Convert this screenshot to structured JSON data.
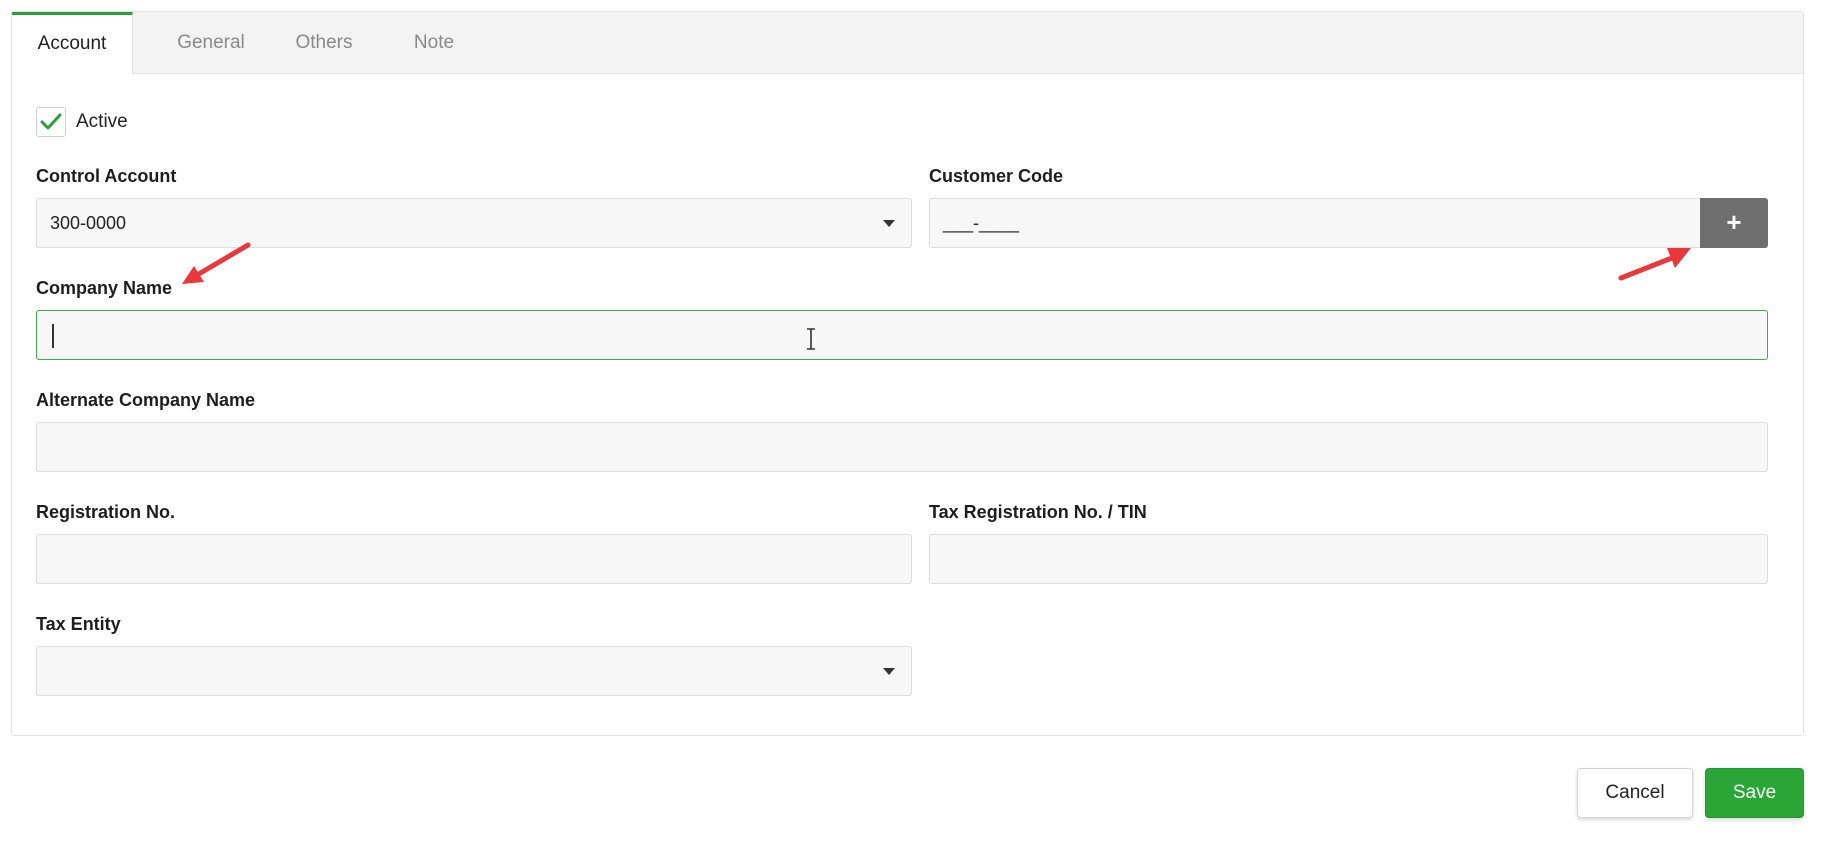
{
  "tabs": [
    {
      "label": "Account",
      "active": true
    },
    {
      "label": "General",
      "active": false
    },
    {
      "label": "Others",
      "active": false
    },
    {
      "label": "Note",
      "active": false
    }
  ],
  "active_checkbox": {
    "label": "Active",
    "checked": true
  },
  "fields": {
    "control_account": {
      "label": "Control Account",
      "value": "300-0000"
    },
    "customer_code": {
      "label": "Customer Code",
      "value": "___-____",
      "add_label": "+"
    },
    "company_name": {
      "label": "Company Name",
      "value": ""
    },
    "alternate_company_name": {
      "label": "Alternate Company Name",
      "value": ""
    },
    "registration_no": {
      "label": "Registration No.",
      "value": ""
    },
    "tax_registration_no": {
      "label": "Tax Registration No. / TIN",
      "value": ""
    },
    "tax_entity": {
      "label": "Tax Entity",
      "value": ""
    }
  },
  "actions": {
    "cancel_label": "Cancel",
    "save_label": "Save"
  },
  "colors": {
    "accent": "#2aa637",
    "focus_border": "#3fae49",
    "annotation_arrow": "#e8383b",
    "add_button": "#6e6e6e"
  },
  "icons": {
    "checkbox": "checkmark-icon",
    "dropdown": "caret-down-icon",
    "annotation": "red-arrow-icon",
    "text_pointer": "i-beam-cursor-icon"
  }
}
